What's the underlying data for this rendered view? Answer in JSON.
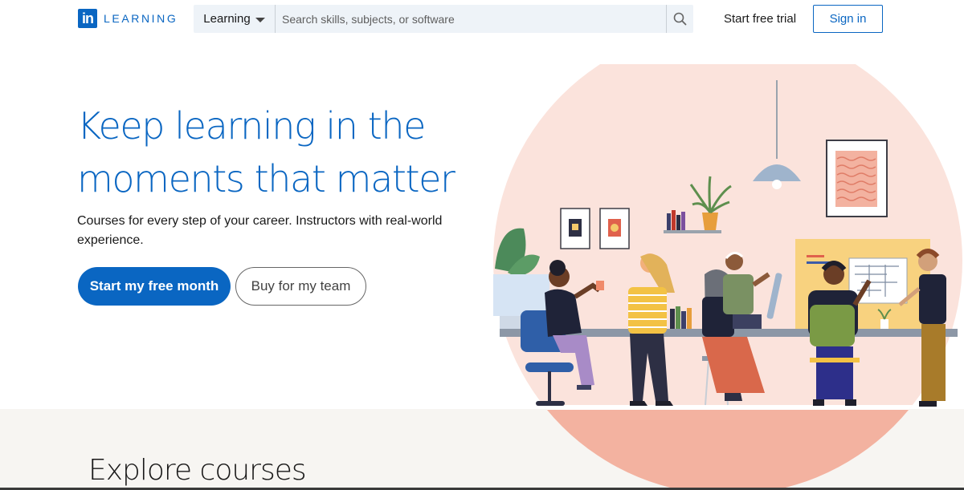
{
  "header": {
    "logo_mark": "in",
    "logo_text": "LEARNING",
    "search": {
      "scope_label": "Learning",
      "placeholder": "Search skills, subjects, or software"
    },
    "start_trial_label": "Start free trial",
    "sign_in_label": "Sign in"
  },
  "hero": {
    "title_line1": "Keep learning in the",
    "title_line2": "moments that matter",
    "subtitle": "Courses for every step of your career. Instructors with real-world experience.",
    "primary_cta": "Start my free month",
    "secondary_cta": "Buy for my team"
  },
  "explore": {
    "title": "Explore courses"
  },
  "colors": {
    "brand_blue": "#0a66c2",
    "circle_pink": "#fbe3dc",
    "explore_band": "#f7f5f2"
  },
  "icons": {
    "search": "search-icon",
    "caret": "chevron-down-icon"
  }
}
